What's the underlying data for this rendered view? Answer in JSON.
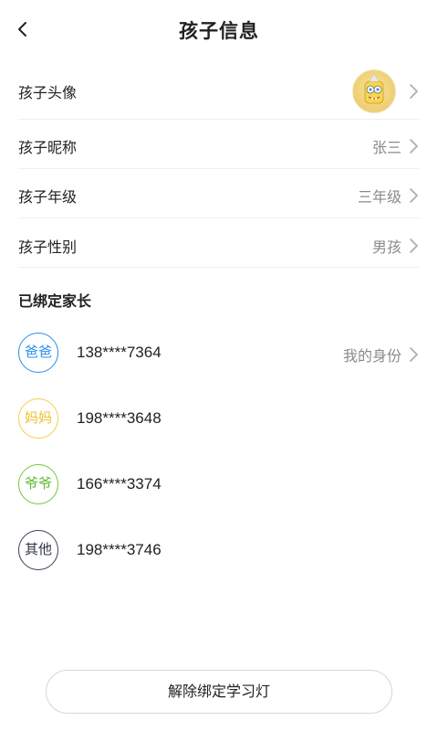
{
  "header": {
    "title": "孩子信息"
  },
  "profile": {
    "avatar_label": "孩子头像",
    "nickname_label": "孩子昵称",
    "nickname_value": "张三",
    "grade_label": "孩子年级",
    "grade_value": "三年级",
    "gender_label": "孩子性别",
    "gender_value": "男孩"
  },
  "parents": {
    "section_title": "已绑定家长",
    "items": [
      {
        "role": "爸爸",
        "phone": "138****7364",
        "color": "#2a8ef0",
        "identity": "我的身份"
      },
      {
        "role": "妈妈",
        "phone": "198****3648",
        "color": "#f5cf45"
      },
      {
        "role": "爷爷",
        "phone": "166****3374",
        "color": "#6fc83a"
      },
      {
        "role": "其他",
        "phone": "198****3746",
        "color": "#3a3f55"
      }
    ]
  },
  "actions": {
    "unbind_label": "解除绑定学习灯"
  },
  "icons": {
    "back": "back-arrow-icon",
    "chevron": "chevron-right-icon"
  }
}
